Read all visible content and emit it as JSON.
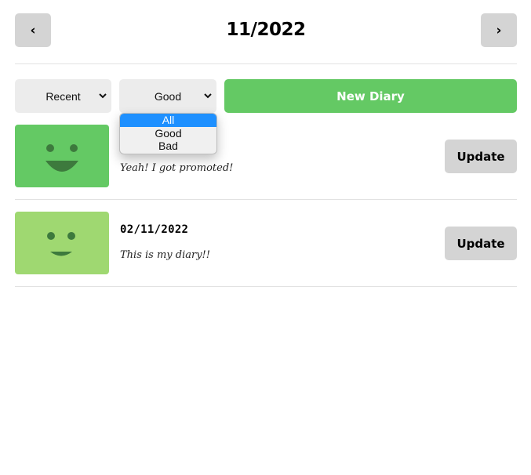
{
  "header": {
    "title": "11/2022",
    "prev_label": "‹",
    "next_label": "›"
  },
  "controls": {
    "sort_select": {
      "selected": "Recent"
    },
    "filter_select": {
      "selected": "Good",
      "options": [
        "All",
        "Good",
        "Bad"
      ],
      "highlighted": "All"
    },
    "new_button_label": "New Diary",
    "accent_color": "#64c964"
  },
  "diary_items": [
    {
      "date": "",
      "content": "Yeah! I got promoted!",
      "emotion_icon": "big-smile-icon",
      "thumb_color": "#64c964",
      "update_label": "Update"
    },
    {
      "date": "02/11/2022",
      "content": "This is my diary!!",
      "emotion_icon": "smile-icon",
      "thumb_color": "#9fd871",
      "update_label": "Update"
    }
  ]
}
